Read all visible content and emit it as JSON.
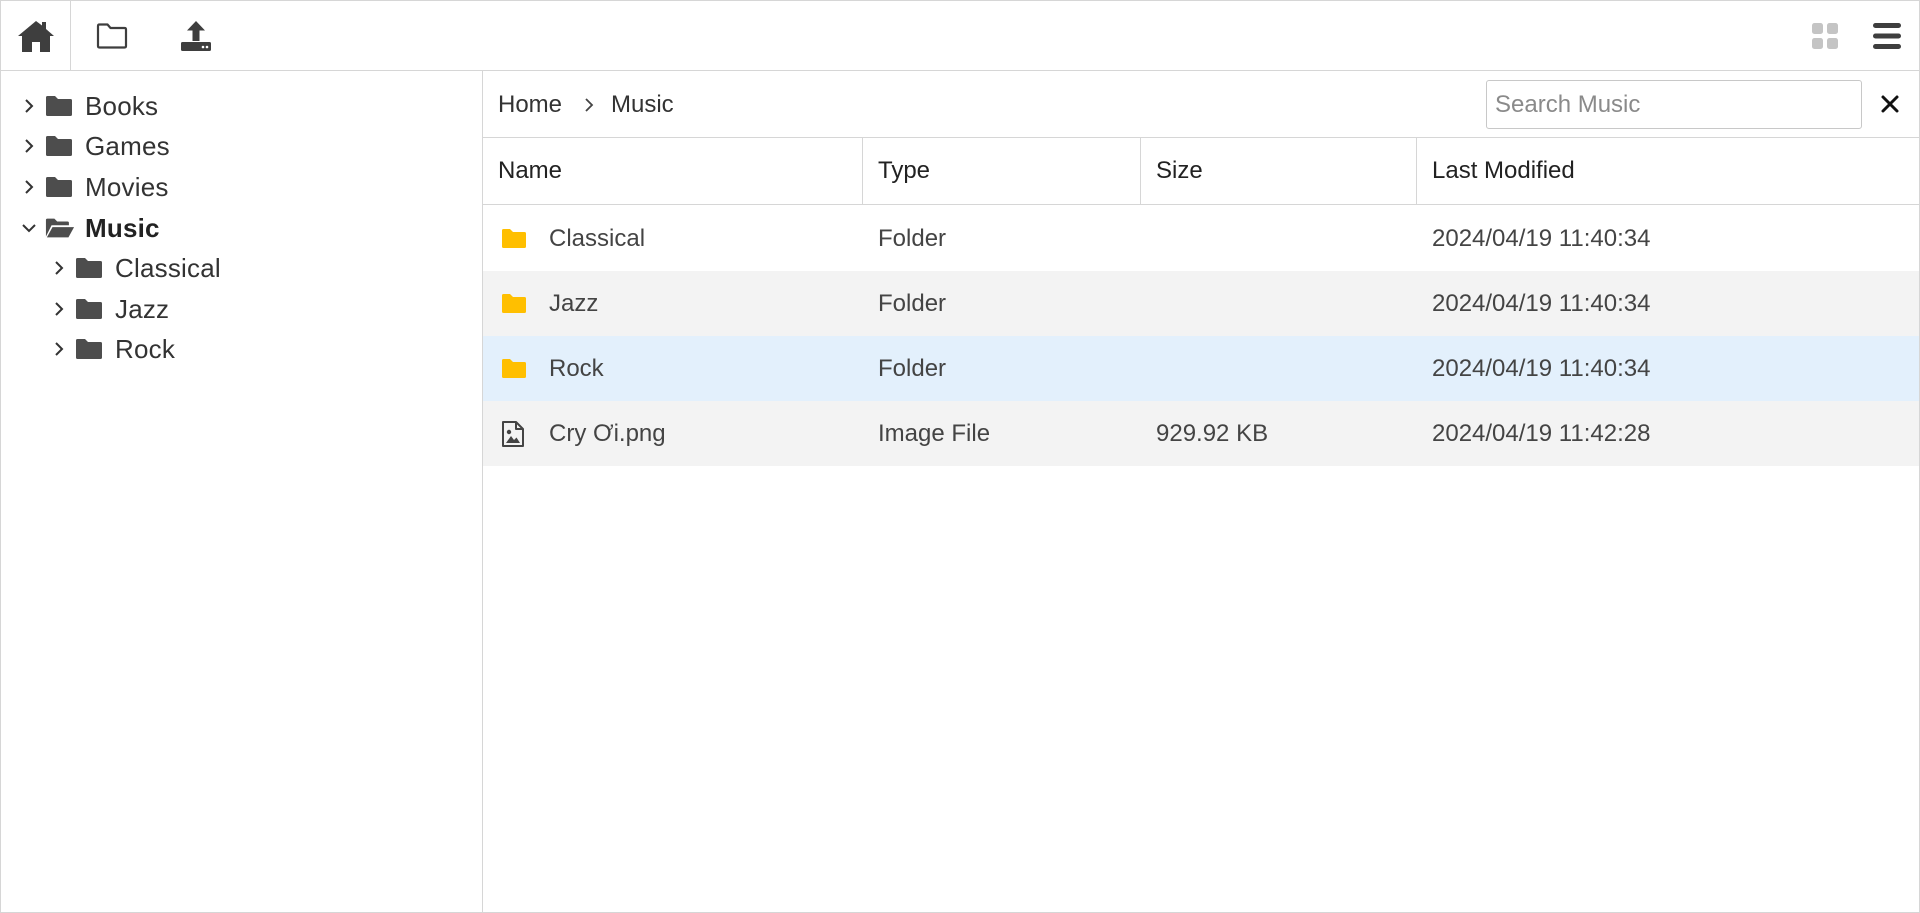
{
  "toolbar": {
    "home_icon": "home-icon",
    "new_folder_icon": "folder-outline-icon",
    "upload_icon": "upload-icon",
    "grid_view_icon": "grid-view-icon",
    "menu_icon": "hamburger-menu-icon"
  },
  "sidebar": {
    "items": [
      {
        "label": "Books",
        "expanded": false,
        "bold": false,
        "level": 0
      },
      {
        "label": "Games",
        "expanded": false,
        "bold": false,
        "level": 0
      },
      {
        "label": "Movies",
        "expanded": false,
        "bold": false,
        "level": 0
      },
      {
        "label": "Music",
        "expanded": true,
        "bold": true,
        "level": 0
      },
      {
        "label": "Classical",
        "expanded": false,
        "bold": false,
        "level": 1
      },
      {
        "label": "Jazz",
        "expanded": false,
        "bold": false,
        "level": 1
      },
      {
        "label": "Rock",
        "expanded": false,
        "bold": false,
        "level": 1
      }
    ]
  },
  "breadcrumb": {
    "home": "Home",
    "separator": "›",
    "current": "Music"
  },
  "search": {
    "placeholder": "Search Music",
    "value": ""
  },
  "grid": {
    "columns": [
      "Name",
      "Type",
      "Size",
      "Last Modified"
    ],
    "rows": [
      {
        "icon": "folder-icon",
        "name": "Classical",
        "type": "Folder",
        "size": "",
        "modified": "2024/04/19 11:40:34",
        "state": "normal"
      },
      {
        "icon": "folder-icon",
        "name": "Jazz",
        "type": "Folder",
        "size": "",
        "modified": "2024/04/19 11:40:34",
        "state": "alt"
      },
      {
        "icon": "folder-icon",
        "name": "Rock",
        "type": "Folder",
        "size": "",
        "modified": "2024/04/19 11:40:34",
        "state": "selected"
      },
      {
        "icon": "image-file-icon",
        "name": "Cry Ơi.png",
        "type": "Image File",
        "size": "929.92 KB",
        "modified": "2024/04/19 11:42:28",
        "state": "alt"
      }
    ]
  },
  "colors": {
    "folder_tree": "#4d4d4d",
    "folder_grid": "#ffbf00",
    "selected_row": "#e3f0fc",
    "alt_row": "#f3f3f3",
    "border": "#d6d6d6"
  }
}
